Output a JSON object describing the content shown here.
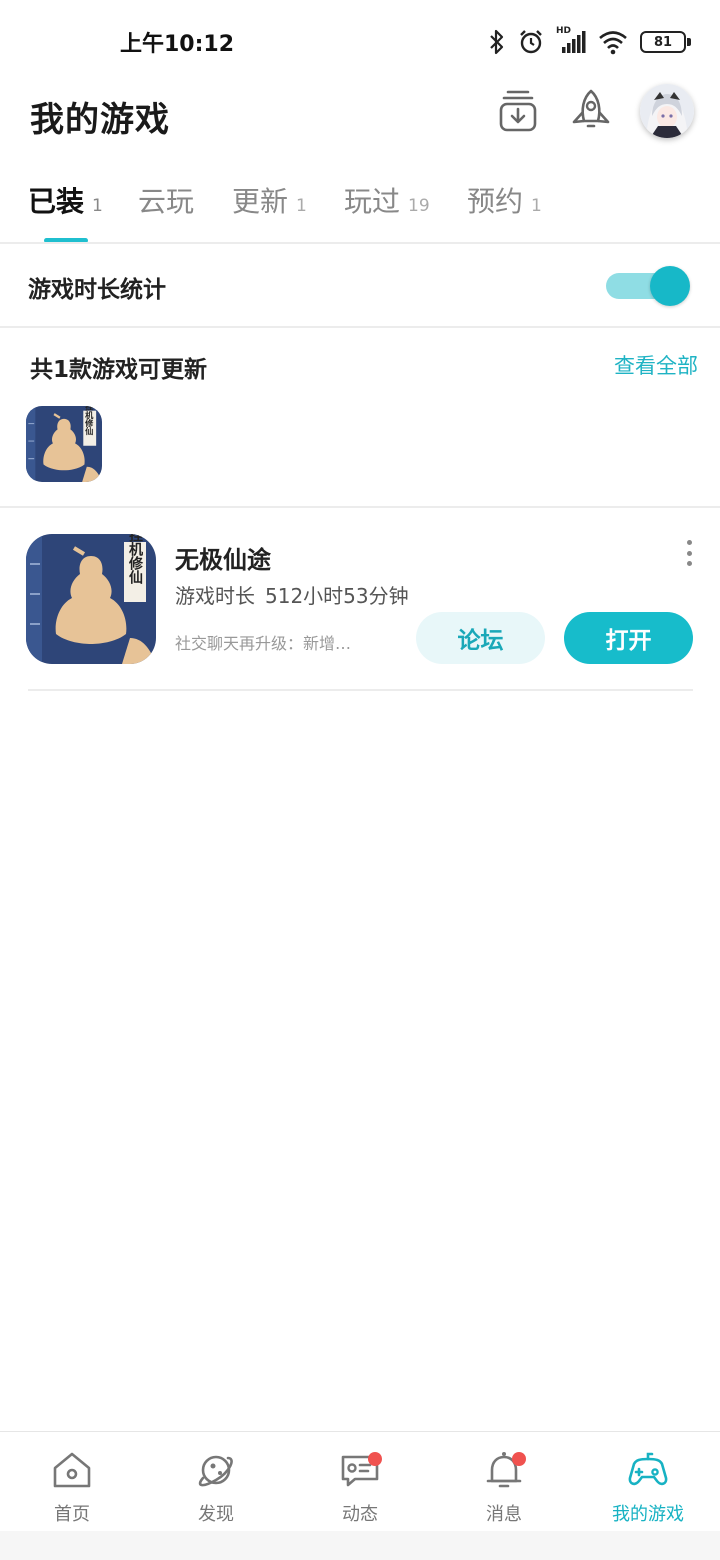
{
  "status_bar": {
    "time": "上午10:12",
    "battery": "81",
    "network_label": "HD"
  },
  "header": {
    "title": "我的游戏"
  },
  "tabs": [
    {
      "label": "已装",
      "count": "1",
      "active": true
    },
    {
      "label": "云玩",
      "count": ""
    },
    {
      "label": "更新",
      "count": "1"
    },
    {
      "label": "玩过",
      "count": "19"
    },
    {
      "label": "预约",
      "count": "1"
    }
  ],
  "stats": {
    "label": "游戏时长统计",
    "enabled": true
  },
  "updates": {
    "title": "共1款游戏可更新",
    "view_all": "查看全部"
  },
  "game_icon_text": "挂机修仙",
  "game": {
    "name": "无极仙途",
    "playtime_label": "游戏时长",
    "playtime_value": "512小时53分钟",
    "news": "社交聊天再升级：新增…",
    "forum_label": "论坛",
    "open_label": "打开"
  },
  "bottom_nav": [
    {
      "label": "首页",
      "icon": "home-icon"
    },
    {
      "label": "发现",
      "icon": "planet-icon"
    },
    {
      "label": "动态",
      "icon": "chat-card-icon",
      "badge": true
    },
    {
      "label": "消息",
      "icon": "bell-icon",
      "badge": true
    },
    {
      "label": "我的游戏",
      "icon": "gamepad-icon",
      "active": true
    }
  ],
  "colors": {
    "accent": "#17bccb",
    "badge": "#f0524f"
  }
}
